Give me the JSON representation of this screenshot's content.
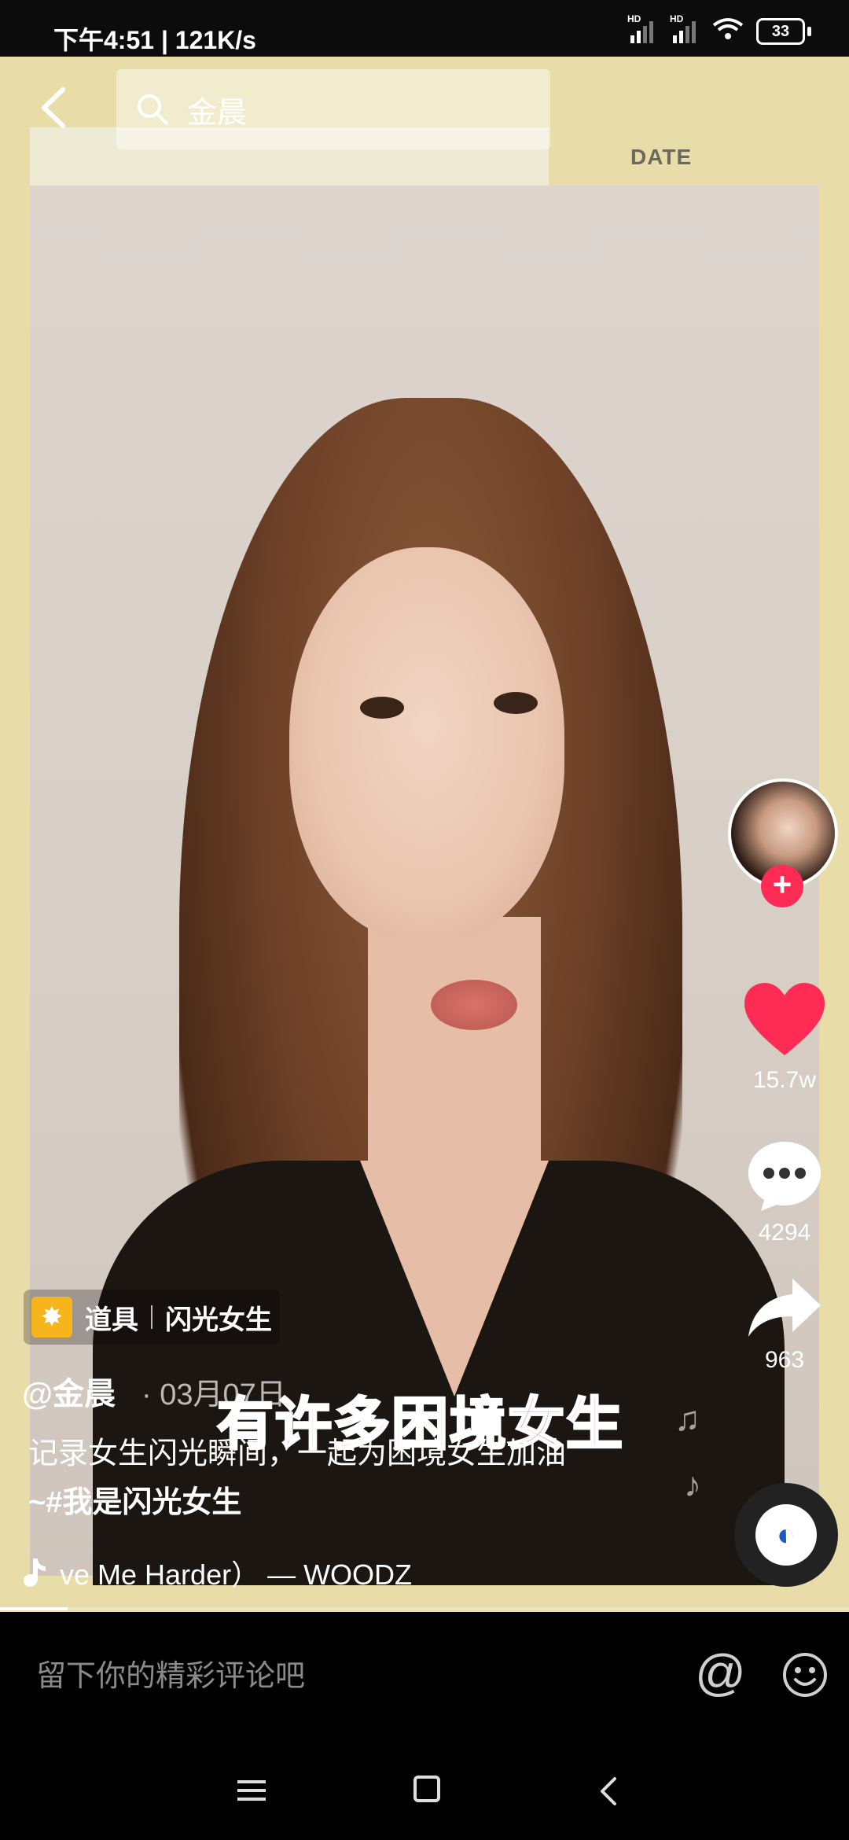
{
  "status_bar": {
    "time_speed": "下午4:51 | 121K/s",
    "signal1_label": "HD",
    "signal2_label": "HD",
    "battery": "33"
  },
  "search": {
    "query": "金晨"
  },
  "video": {
    "frame_tag": "DATE",
    "subtitle": "有许多困境女生"
  },
  "rail": {
    "like_count": "15.7w",
    "comment_count": "4294",
    "share_count": "963"
  },
  "info": {
    "prop_label": "道具",
    "prop_name": "闪光女生",
    "author": "@金晨",
    "date": "· 03月07日",
    "desc_line1": "记录女生闪光瞬间，一起为困境女生加油",
    "desc_line2": "~#我是闪光女生",
    "music": "ve Me Harder） — WOODZ"
  },
  "comment_bar": {
    "placeholder": "留下你的精彩评论吧",
    "at_symbol": "@"
  },
  "progress": 0.08,
  "colors": {
    "like": "#fe2c55",
    "follow": "#fe2c55",
    "prop_icon_bg": "#f7b51d"
  }
}
